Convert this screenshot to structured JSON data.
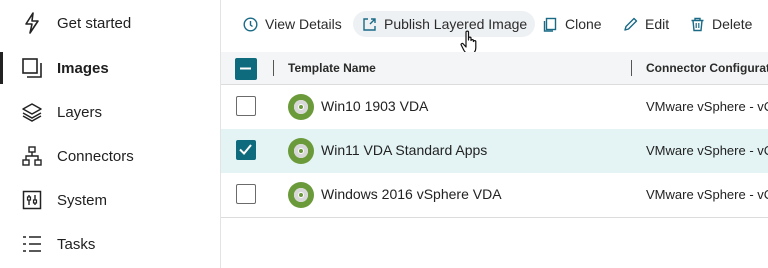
{
  "sidebar": {
    "items": [
      {
        "label": "Get started",
        "icon": "lightning-icon"
      },
      {
        "label": "Images",
        "icon": "images-icon",
        "active": true
      },
      {
        "label": "Layers",
        "icon": "layers-icon"
      },
      {
        "label": "Connectors",
        "icon": "connectors-icon"
      },
      {
        "label": "System",
        "icon": "system-icon"
      },
      {
        "label": "Tasks",
        "icon": "tasks-icon"
      }
    ]
  },
  "toolbar": {
    "view_details": "View Details",
    "publish": "Publish Layered Image",
    "clone": "Clone",
    "edit": "Edit",
    "delete": "Delete"
  },
  "table": {
    "columns": [
      "Template Name",
      "Connector Configuratio"
    ],
    "rows": [
      {
        "name": "Win10 1903 VDA",
        "connector": "VMware vSphere - vC",
        "selected": false
      },
      {
        "name": "Win11 VDA Standard Apps",
        "connector": "VMware vSphere - vC",
        "selected": true
      },
      {
        "name": "Windows 2016 vSphere VDA",
        "connector": "VMware vSphere - vC",
        "selected": false
      }
    ]
  },
  "colors": {
    "accent": "#0e6b7d",
    "selected_row": "#e4f4f4",
    "image_icon": "#6a9a3a"
  }
}
